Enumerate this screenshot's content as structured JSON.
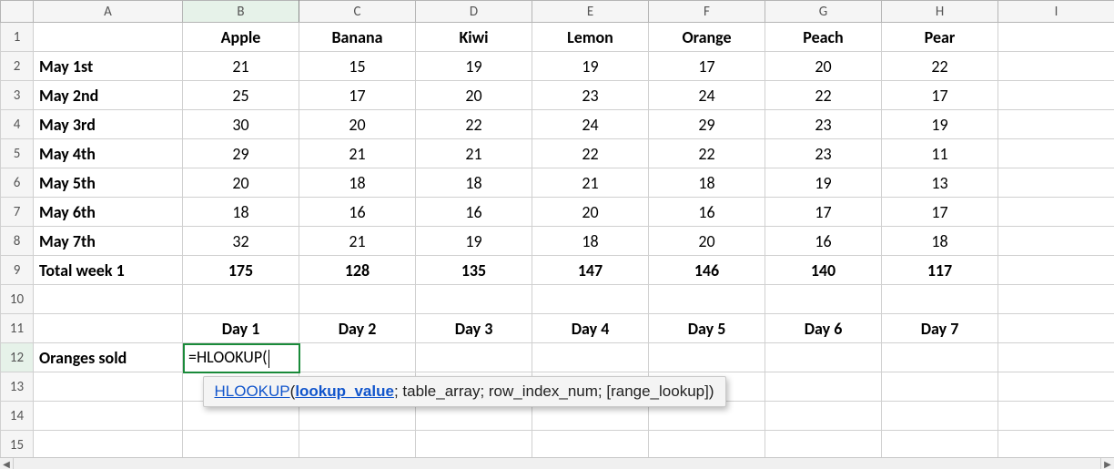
{
  "columns": [
    "A",
    "B",
    "C",
    "D",
    "E",
    "F",
    "G",
    "H",
    "I"
  ],
  "rows": [
    1,
    2,
    3,
    4,
    5,
    6,
    7,
    8,
    9,
    10,
    11,
    12,
    13,
    14,
    15
  ],
  "col_headers": [
    "",
    "Apple",
    "Banana",
    "Kiwi",
    "Lemon",
    "Orange",
    "Peach",
    "Pear",
    ""
  ],
  "row_labels": [
    "",
    "May 1st",
    "May 2nd",
    "May 3rd",
    "May 4th",
    "May 5th",
    "May 6th",
    "May 7th",
    "Total week 1",
    "",
    "",
    "Oranges sold",
    "",
    "",
    ""
  ],
  "data": {
    "2": [
      21,
      15,
      19,
      19,
      17,
      20,
      22
    ],
    "3": [
      25,
      17,
      20,
      23,
      24,
      22,
      17
    ],
    "4": [
      30,
      20,
      22,
      24,
      29,
      23,
      19
    ],
    "5": [
      29,
      21,
      21,
      22,
      22,
      23,
      11
    ],
    "6": [
      20,
      18,
      18,
      21,
      18,
      19,
      13
    ],
    "7": [
      18,
      16,
      16,
      20,
      16,
      17,
      17
    ],
    "8": [
      32,
      21,
      19,
      18,
      20,
      16,
      18
    ],
    "9": [
      175,
      128,
      135,
      147,
      146,
      140,
      117
    ]
  },
  "day_row": [
    "Day 1",
    "Day 2",
    "Day 3",
    "Day 4",
    "Day 5",
    "Day 6",
    "Day 7"
  ],
  "active_cell": {
    "row": 12,
    "col": "B",
    "formula": "=HLOOKUP("
  },
  "selected_column": "B",
  "selected_row": 12,
  "tooltip": {
    "fn": "HLOOKUP",
    "active_arg": "lookup_value",
    "rest": "; table_array; row_index_num; [range_lookup])"
  }
}
